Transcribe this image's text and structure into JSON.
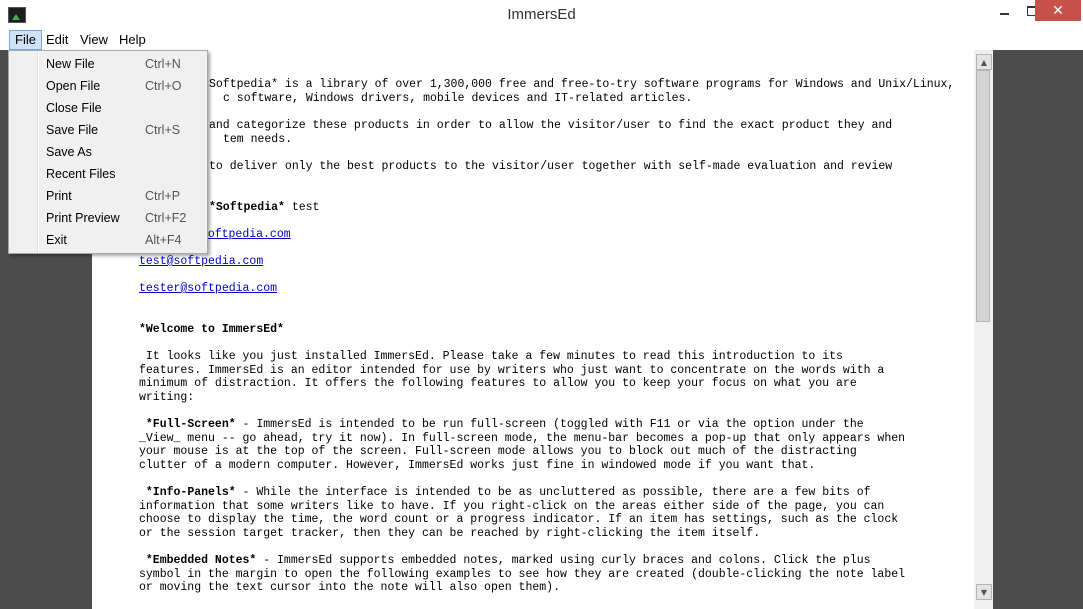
{
  "window": {
    "title": "ImmersEd"
  },
  "menubar": {
    "file": "File",
    "edit": "Edit",
    "view": "View",
    "help": "Help"
  },
  "file_menu": [
    {
      "label": "New File",
      "shortcut": "Ctrl+N"
    },
    {
      "label": "Open File",
      "shortcut": "Ctrl+O"
    },
    {
      "label": "Close File",
      "shortcut": ""
    },
    {
      "label": "Save File",
      "shortcut": "Ctrl+S"
    },
    {
      "label": "Save As",
      "shortcut": ""
    },
    {
      "label": "Recent Files",
      "shortcut": ""
    },
    {
      "label": "Print",
      "shortcut": "Ctrl+P"
    },
    {
      "label": "Print Preview",
      "shortcut": "Ctrl+F2"
    },
    {
      "label": "Exit",
      "shortcut": "Alt+F4"
    }
  ],
  "doc": {
    "p1a": "Softpedia* is a library of over 1,300,000 free and free-to-try software programs for Windows and Unix/Linux,",
    "p1b": "c software, Windows drivers, mobile devices and IT-related articles.",
    "p2a": "and categorize these products in order to allow the visitor/user to find the exact product they and",
    "p2b": "tem needs.",
    "p3": "to deliver only the best products to the visitor/user together with self-made evaluation and review",
    "p4_bold": "*Softpedia*",
    "p4_rest": " test",
    "link1": "http://www.softpedia.com",
    "link2": "test@softpedia.com",
    "link3": "tester@softpedia.com",
    "welcome": "*Welcome to ImmersEd*",
    "intro": " It looks like you just installed ImmersEd. Please take a few minutes to read this introduction to its\nfeatures. ImmersEd is an editor intended for use by writers who just want to concentrate on the words with a\nminimum of distraction. It offers the following features to allow you to keep your focus on what you are\nwriting:",
    "fs_bold": " *Full-Screen*",
    "fs_rest": " - ImmersEd is intended to be run full-screen (toggled with F11 or via the option under the\n_View_ menu -- go ahead, try it now). In full-screen mode, the menu-bar becomes a pop-up that only appears when\nyour mouse is at the top of the screen. Full-screen mode allows you to block out much of the distracting\nclutter of a modern computer. However, ImmersEd works just fine in windowed mode if you want that.",
    "ip_bold": " *Info-Panels*",
    "ip_rest": " - While the interface is intended to be as uncluttered as possible, there are a few bits of\ninformation that some writers like to have. If you right-click on the areas either side of the page, you can\nchoose to display the time, the word count or a progress indicator. If an item has settings, such as the clock\nor the session target tracker, then they can be reached by right-clicking the item itself.",
    "en_bold": " *Embedded Notes*",
    "en_rest": " - ImmersEd supports embedded notes, marked using curly braces and colons. Click the plus\nsymbol in the margin to open the following examples to see how they are created (double-clicking the note label\nor moving the text cursor into the note will also open them)."
  }
}
